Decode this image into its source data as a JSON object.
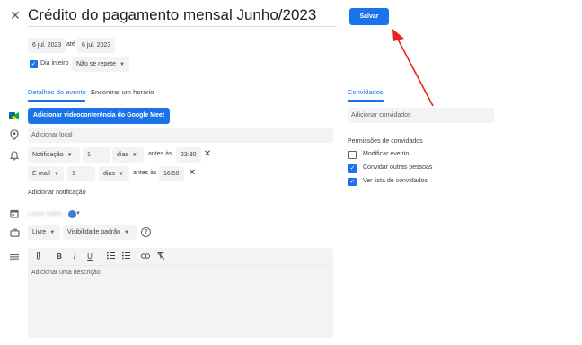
{
  "header": {
    "close_icon": "close-icon",
    "title": "Crédito do pagamento mensal Junho/2023",
    "save_label": "Salvar"
  },
  "dates": {
    "start_date": "6 jul. 2023",
    "to_label": "até",
    "end_date": "6 jul. 2023",
    "all_day_label": "Dia inteiro",
    "all_day_checked": true,
    "repeat": "Não se repete"
  },
  "tabs": {
    "details": "Detalhes do evento",
    "find_time": "Encontrar um horário"
  },
  "meet": {
    "button_label": "Adicionar videoconferência do Google Meet"
  },
  "location": {
    "placeholder": "Adicionar local"
  },
  "notifications": [
    {
      "type": "Notificação",
      "amount": "1",
      "unit": "dias",
      "before_label": "antes às",
      "time": "23:30"
    },
    {
      "type": "E-mail",
      "amount": "1",
      "unit": "dias",
      "before_label": "antes às",
      "time": "16:50"
    }
  ],
  "add_notification": "Adicionar notificação",
  "calendar": {
    "owner": "Laura Yalles",
    "color": "#3f7bd6"
  },
  "availability": {
    "status": "Livre",
    "visibility": "Visibilidade padrão"
  },
  "description": {
    "placeholder": "Adicionar uma descrição"
  },
  "guests": {
    "tab_label": "Convidados",
    "add_placeholder": "Adicionar convidados",
    "permissions_title": "Permissões de convidados",
    "permissions": [
      {
        "label": "Modificar evento",
        "checked": false
      },
      {
        "label": "Convidar outras pessoas",
        "checked": true
      },
      {
        "label": "Ver lista de convidados",
        "checked": true
      }
    ]
  },
  "colors": {
    "accent": "#1a73e8",
    "annotation_arrow": "#e8221b"
  }
}
